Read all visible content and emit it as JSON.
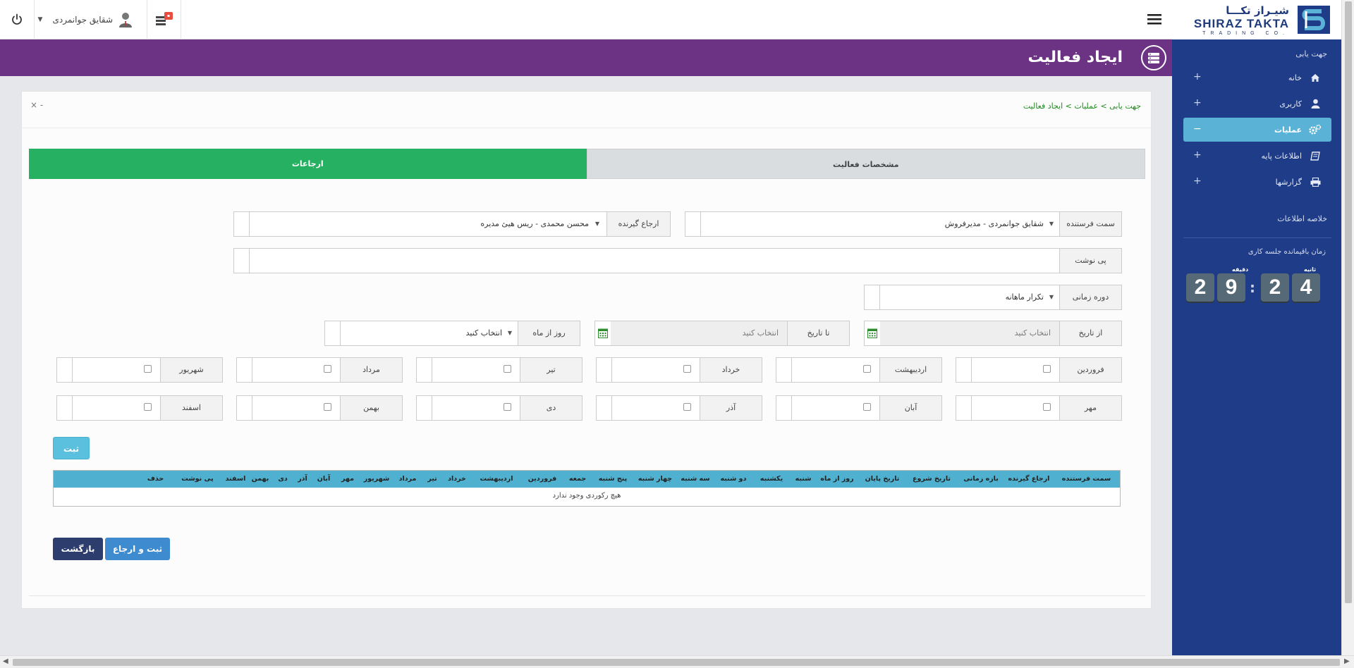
{
  "topbar": {
    "user_name": "شقایق جوانمردی",
    "user_caret": "▼"
  },
  "header": {
    "page_title": "ایجاد فعالیت"
  },
  "logo": {
    "fa": "شیـراز تکـــا",
    "en": "SHIRAZ TAKTA",
    "sub": "TRADING CO."
  },
  "sidebar": {
    "nav_heading": "جهت یابی",
    "items": [
      {
        "label": "خانه",
        "icon": "home-icon",
        "expand": "+"
      },
      {
        "label": "کاربری",
        "icon": "user-icon",
        "expand": "+"
      },
      {
        "label": "عملیات",
        "icon": "gears-icon",
        "expand": "−"
      },
      {
        "label": "اطلاعات پایه",
        "icon": "book-icon",
        "expand": "+"
      },
      {
        "label": "گزارشها",
        "icon": "print-icon",
        "expand": "+"
      }
    ],
    "summary_heading": "خلاصه اطلاعات",
    "timer_label": "زمان باقیمانده جلسه کاری",
    "timer": {
      "minutes_label": "دقیقه",
      "seconds_label": "ثانیه",
      "digits": [
        "2",
        "9",
        "2",
        "4"
      ],
      "separator": ":"
    }
  },
  "panel": {
    "breadcrumb": "جهت یابی > عملیات > ایجاد فعالیت",
    "tools": "×  -",
    "tabs": {
      "specs": "مشخصات فعالیت",
      "referrals": "ارجاعات"
    }
  },
  "form": {
    "sender_label": "سمت فرستنده",
    "sender_value": "شقایق جوانمردی - مدیرفروش",
    "receiver_label": "ارجاع گیرنده",
    "receiver_value": "محسن محمدی - ریس هیئ مدیره",
    "note_label": "پی نوشت",
    "note_value": "",
    "period_label": "دوره زمانی",
    "period_value": "تکرار ماهانه",
    "from_label": "از تاریخ",
    "from_placeholder": "انتخاب کنید",
    "to_label": "تا تاریخ",
    "to_placeholder": "انتخاب کنید",
    "day_label": "روز از ماه",
    "day_value": "انتخاب کنید",
    "months_row1": [
      "فروردین",
      "اردیبهشت",
      "خرداد",
      "تیر",
      "مرداد",
      "شهریور"
    ],
    "months_row2": [
      "مهر",
      "آبان",
      "آذر",
      "دی",
      "بهمن",
      "اسفند"
    ],
    "submit_label": "ثبت"
  },
  "table": {
    "headers": [
      "سمت فرستنده",
      "ارجاع گیرنده",
      "بازه زمانی",
      "تاریخ شروع",
      "تاریخ پایان",
      "روز از ماه",
      "شنبه",
      "یکشنبه",
      "دو شنبه",
      "سه شنبه",
      "چهار شنبه",
      "پنج شنبه",
      "جمعه",
      "فروردین",
      "اردیبهشت",
      "خرداد",
      "تیر",
      "مرداد",
      "شهریور",
      "مهر",
      "آبان",
      "آذر",
      "دی",
      "بهمن",
      "اسفند",
      "پی نوشت",
      "حذف"
    ],
    "empty_message": "هیچ رکوردی وجود ندارد"
  },
  "actions": {
    "send_label": "ثبت و ارجاع",
    "back_label": "بازگشت"
  },
  "colors": {
    "header_purple": "#6c3283",
    "sidebar_blue": "#1f3c88",
    "tab_green": "#26b061",
    "table_head": "#4fb0cf"
  }
}
